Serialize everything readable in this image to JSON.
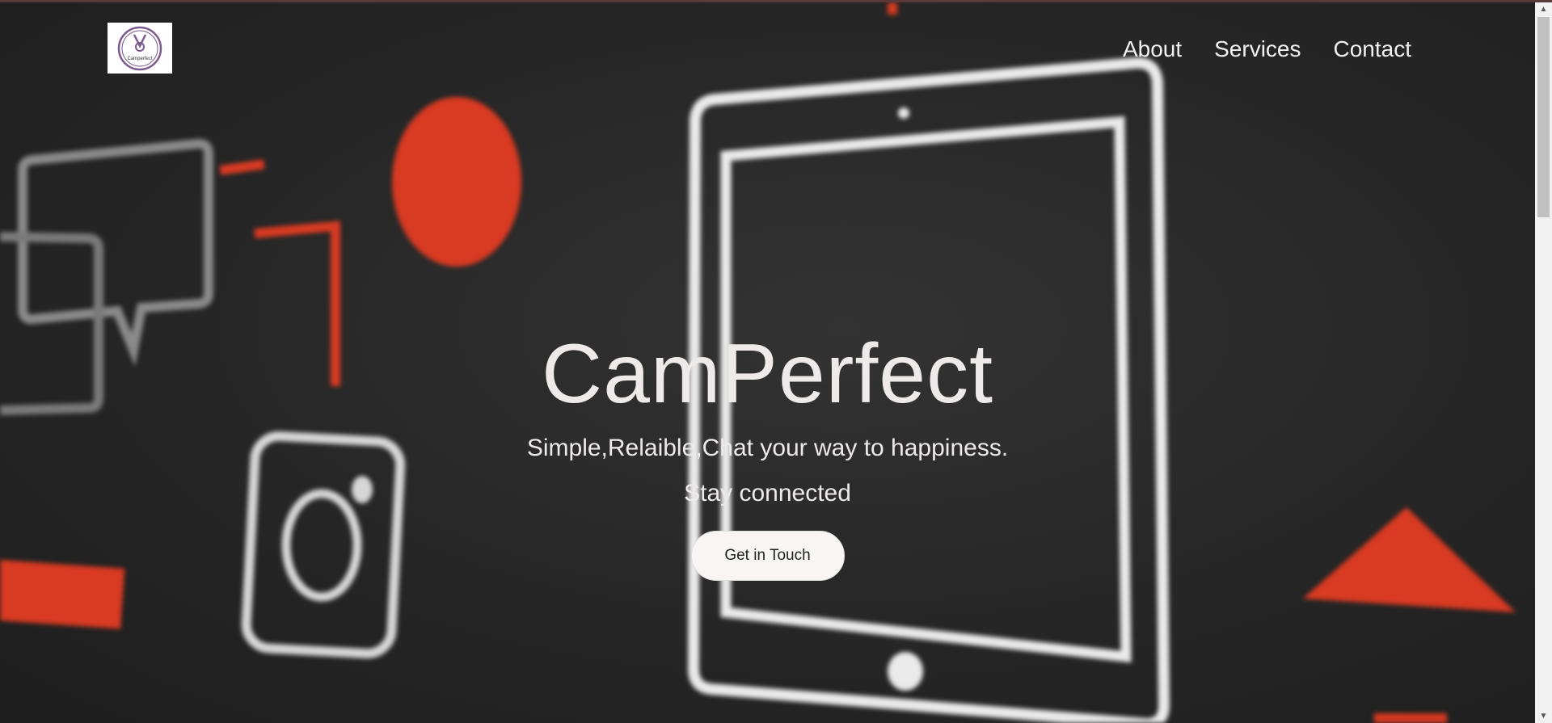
{
  "brand": {
    "logo_text": "Camperfect",
    "logo_icon": "medal-icon",
    "accent_color": "#7b5a8e"
  },
  "nav": {
    "items": [
      {
        "label": "About"
      },
      {
        "label": "Services"
      },
      {
        "label": "Contact"
      }
    ]
  },
  "hero": {
    "title": "CamPerfect",
    "tagline": "Simple,Relaible,Chat your way to happiness.",
    "subtitle": "Stay connected",
    "cta_label": "Get in Touch",
    "background_colors": {
      "dark": "#262626",
      "red": "#d83a22",
      "white": "#e8e8e8"
    }
  },
  "scrollbar": {
    "up_icon": "triangle-up-icon",
    "down_icon": "triangle-down-icon"
  }
}
